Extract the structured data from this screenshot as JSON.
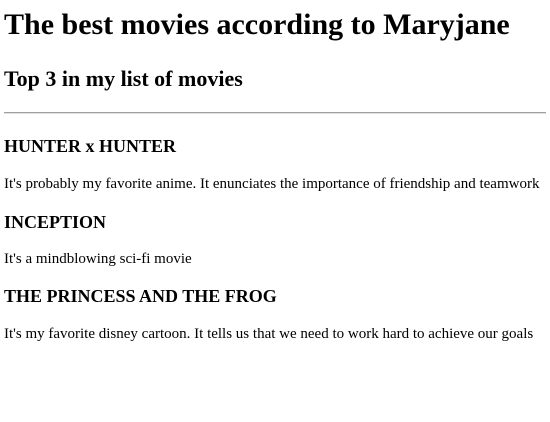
{
  "page": {
    "title": "The best movies according to Maryjane",
    "subtitle": "Top 3 in my list of movies"
  },
  "movies": [
    {
      "name": "HUNTER x HUNTER",
      "description": "It's probably my favorite anime. It enunciates the importance of friendship and teamwork"
    },
    {
      "name": "INCEPTION",
      "description": "It's a mindblowing sci-fi movie"
    },
    {
      "name": "THE PRINCESS AND THE FROG",
      "description": "It's my favorite disney cartoon. It tells us that we need to work hard to achieve our goals"
    }
  ]
}
